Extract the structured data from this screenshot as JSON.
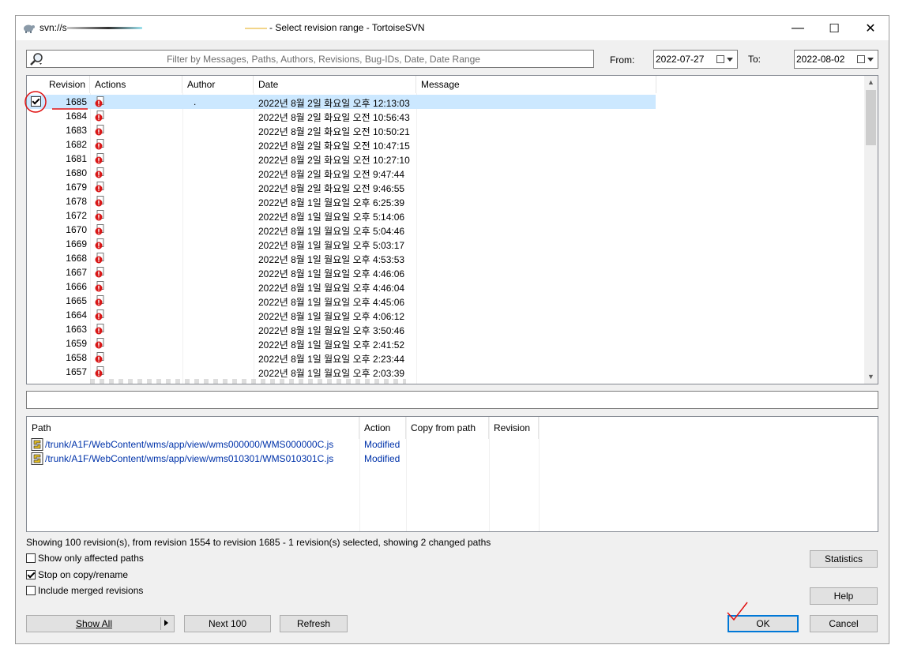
{
  "window": {
    "title_prefix": "svn://s",
    "title_suffix": "- Select revision range - TortoiseSVN",
    "minimize": "—",
    "maximize": "☐",
    "close": "✕"
  },
  "filter": {
    "placeholder": "Filter by Messages, Paths, Authors, Revisions, Bug-IDs, Date, Date Range",
    "from_label": "From:",
    "from_value": "2022-07-27",
    "to_label": "To:",
    "to_value": "2022-08-02"
  },
  "log": {
    "columns": [
      "Revision",
      "Actions",
      "Author",
      "Date",
      "Message"
    ],
    "rows": [
      {
        "revision": "1685",
        "author": ".",
        "date": "2022년 8월 2일 화요일 오후 12:13:03",
        "selected": true
      },
      {
        "revision": "1684",
        "author": "",
        "date": "2022년 8월 2일 화요일 오전 10:56:43"
      },
      {
        "revision": "1683",
        "author": "",
        "date": "2022년 8월 2일 화요일 오전 10:50:21"
      },
      {
        "revision": "1682",
        "author": "",
        "date": "2022년 8월 2일 화요일 오전 10:47:15"
      },
      {
        "revision": "1681",
        "author": "",
        "date": "2022년 8월 2일 화요일 오전 10:27:10"
      },
      {
        "revision": "1680",
        "author": "",
        "date": "2022년 8월 2일 화요일 오전 9:47:44"
      },
      {
        "revision": "1679",
        "author": "",
        "date": "2022년 8월 2일 화요일 오전 9:46:55"
      },
      {
        "revision": "1678",
        "author": "",
        "date": "2022년 8월 1일 월요일 오후 6:25:39"
      },
      {
        "revision": "1672",
        "author": "",
        "date": "2022년 8월 1일 월요일 오후 5:14:06"
      },
      {
        "revision": "1670",
        "author": "",
        "date": "2022년 8월 1일 월요일 오후 5:04:46"
      },
      {
        "revision": "1669",
        "author": "",
        "date": "2022년 8월 1일 월요일 오후 5:03:17"
      },
      {
        "revision": "1668",
        "author": "",
        "date": "2022년 8월 1일 월요일 오후 4:53:53"
      },
      {
        "revision": "1667",
        "author": "",
        "date": "2022년 8월 1일 월요일 오후 4:46:06"
      },
      {
        "revision": "1666",
        "author": "",
        "date": "2022년 8월 1일 월요일 오후 4:46:04"
      },
      {
        "revision": "1665",
        "author": "",
        "date": "2022년 8월 1일 월요일 오후 4:45:06"
      },
      {
        "revision": "1664",
        "author": "",
        "date": "2022년 8월 1일 월요일 오후 4:06:12"
      },
      {
        "revision": "1663",
        "author": "",
        "date": "2022년 8월 1일 월요일 오후 3:50:46"
      },
      {
        "revision": "1659",
        "author": "",
        "date": "2022년 8월 1일 월요일 오후 2:41:52"
      },
      {
        "revision": "1658",
        "author": "",
        "date": "2022년 8월 1일 월요일 오후 2:23:44"
      },
      {
        "revision": "1657",
        "author": "",
        "date": "2022년 8월 1일 월요일 오후 2:03:39"
      }
    ]
  },
  "paths": {
    "columns": [
      "Path",
      "Action",
      "Copy from path",
      "Revision"
    ],
    "rows": [
      {
        "path": "/trunk/A1F/WebContent/wms/app/view/wms000000/WMS000000C.js",
        "action": "Modified"
      },
      {
        "path": "/trunk/A1F/WebContent/wms/app/view/wms010301/WMS010301C.js",
        "action": "Modified"
      }
    ]
  },
  "status_text": "Showing 100 revision(s), from revision 1554 to revision 1685 - 1 revision(s) selected, showing 2 changed paths",
  "options": {
    "show_only_affected": {
      "label": "Show only affected paths",
      "checked": false
    },
    "stop_on_copy": {
      "label": "Stop on copy/rename",
      "checked": true
    },
    "include_merged": {
      "label": "Include merged revisions",
      "checked": false
    }
  },
  "buttons": {
    "statistics": "Statistics",
    "help": "Help",
    "show_all": "Show All",
    "next_100": "Next 100",
    "refresh": "Refresh",
    "ok": "OK",
    "cancel": "Cancel"
  },
  "colors": {
    "selection": "#cce8ff",
    "link": "#0033aa",
    "annotation_red": "#e01010",
    "default_button_border": "#0078d7"
  }
}
